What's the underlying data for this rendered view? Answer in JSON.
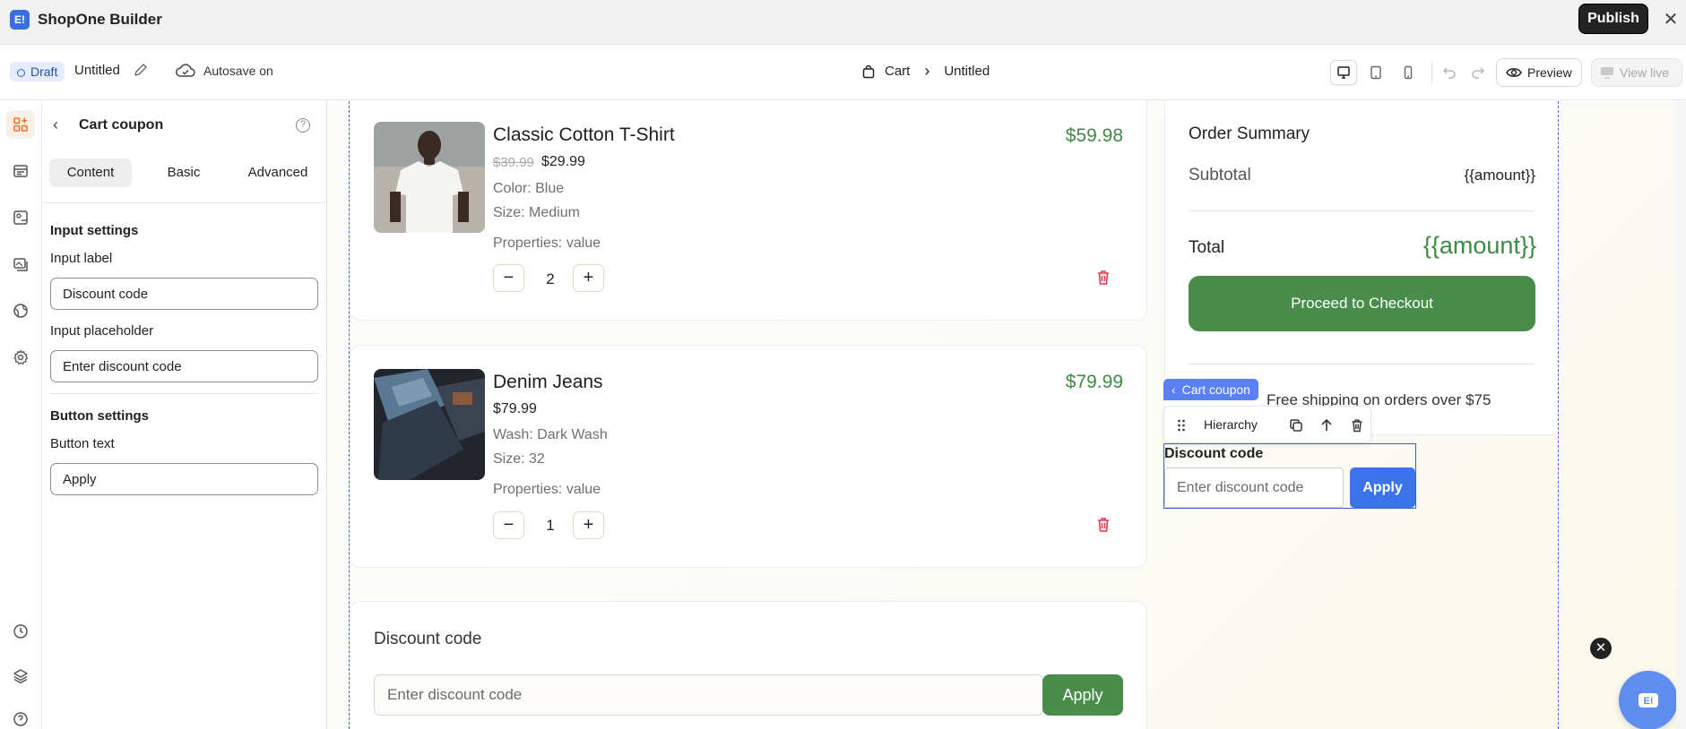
{
  "app": {
    "title": "ShopOne Builder",
    "logo_text": "E!",
    "publish_label": "Publish"
  },
  "toolbar": {
    "status": "Draft",
    "doc_name": "Untitled",
    "autosave": "Autosave on",
    "breadcrumb": [
      "Cart",
      "Untitled"
    ],
    "preview_label": "Preview",
    "view_live_label": "View live"
  },
  "panel": {
    "title": "Cart coupon",
    "tabs": [
      "Content",
      "Basic",
      "Advanced"
    ],
    "active_tab": "Content",
    "input_settings_title": "Input settings",
    "input_label_label": "Input label",
    "input_label_value": "Discount code",
    "input_placeholder_label": "Input placeholder",
    "input_placeholder_value": "Enter discount code",
    "button_settings_title": "Button settings",
    "button_text_label": "Button text",
    "button_text_value": "Apply"
  },
  "cart": {
    "items": [
      {
        "name": "Classic Cotton T-Shirt",
        "total": "$59.98",
        "old_price": "$39.99",
        "price": "$29.99",
        "meta1": "Color: Blue",
        "meta2": "Size: Medium",
        "properties": "Properties: value",
        "qty": "2"
      },
      {
        "name": "Denim Jeans",
        "total": "$79.99",
        "price": "$79.99",
        "meta1": "Wash: Dark Wash",
        "meta2": "Size: 32",
        "properties": "Properties: value",
        "qty": "1"
      }
    ],
    "discount": {
      "title": "Discount code",
      "placeholder": "Enter discount code",
      "apply": "Apply"
    }
  },
  "summary": {
    "title": "Order Summary",
    "subtotal_label": "Subtotal",
    "subtotal_value": "{{amount}}",
    "total_label": "Total",
    "total_value": "{{amount}}",
    "checkout": "Proceed to Checkout",
    "shipping_note": "Free shipping on orders over $75"
  },
  "selection": {
    "tag": "Cart coupon",
    "hierarchy": "Hierarchy",
    "label": "Discount code",
    "placeholder": "Enter discount code",
    "apply": "Apply"
  },
  "colors": {
    "accent_green": "#4a8d4b",
    "selection_blue": "#3b5ed8",
    "brand_blue": "#3b6fe0"
  }
}
